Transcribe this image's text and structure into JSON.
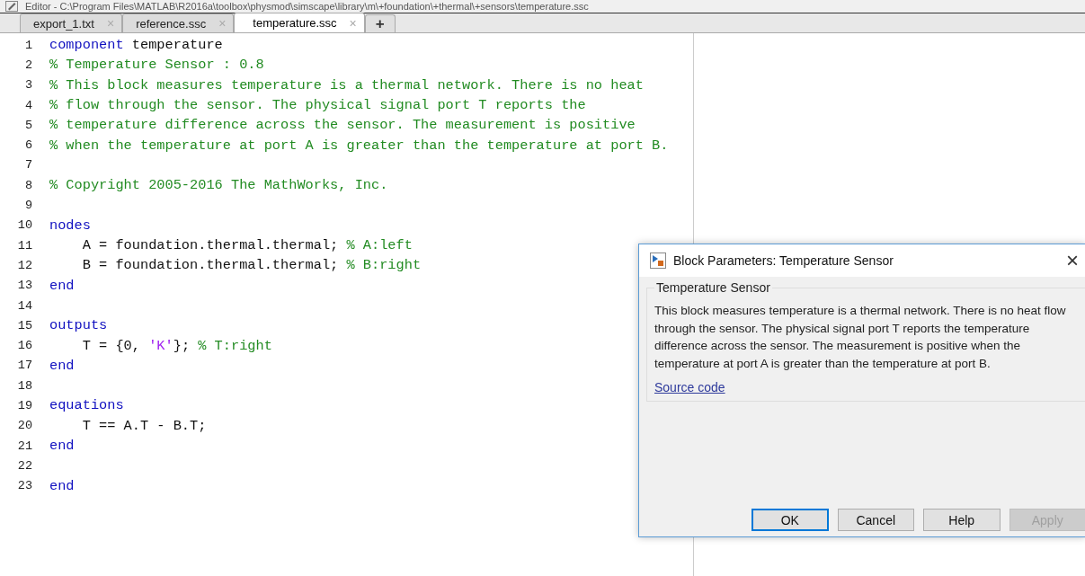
{
  "window": {
    "title": "Editor - C:\\Program Files\\MATLAB\\R2016a\\toolbox\\physmod\\simscape\\library\\m\\+foundation\\+thermal\\+sensors\\temperature.ssc"
  },
  "tabs": [
    {
      "label": "export_1.txt",
      "selected": false,
      "close": "×"
    },
    {
      "label": "reference.ssc",
      "selected": false,
      "close": "×"
    },
    {
      "label": "temperature.ssc",
      "selected": true,
      "close": "×"
    }
  ],
  "new_tab": "+",
  "code": [
    {
      "number": "1",
      "tokens": [
        {
          "kind": "keyword",
          "text": "component"
        },
        {
          "kind": "plain",
          "text": " temperature"
        }
      ]
    },
    {
      "number": "2",
      "tokens": [
        {
          "kind": "comment",
          "text": "% Temperature Sensor : 0.8"
        }
      ]
    },
    {
      "number": "3",
      "tokens": [
        {
          "kind": "comment",
          "text": "% This block measures temperature is a thermal network. There is no heat"
        }
      ]
    },
    {
      "number": "4",
      "tokens": [
        {
          "kind": "comment",
          "text": "% flow through the sensor. The physical signal port T reports the"
        }
      ]
    },
    {
      "number": "5",
      "tokens": [
        {
          "kind": "comment",
          "text": "% temperature difference across the sensor. The measurement is positive"
        }
      ]
    },
    {
      "number": "6",
      "tokens": [
        {
          "kind": "comment",
          "text": "% when the temperature at port A is greater than the temperature at port B."
        }
      ]
    },
    {
      "number": "7"
    },
    {
      "number": "8",
      "tokens": [
        {
          "kind": "comment",
          "text": "% Copyright 2005-2016 The MathWorks, Inc."
        }
      ]
    },
    {
      "number": "9"
    },
    {
      "number": "10",
      "tokens": [
        {
          "kind": "keyword",
          "text": "nodes"
        }
      ]
    },
    {
      "number": "11",
      "tokens": [
        {
          "kind": "plain",
          "text": "    A = foundation.thermal.thermal; "
        },
        {
          "kind": "comment",
          "text": "% A:left"
        }
      ]
    },
    {
      "number": "12",
      "tokens": [
        {
          "kind": "plain",
          "text": "    B = foundation.thermal.thermal; "
        },
        {
          "kind": "comment",
          "text": "% B:right"
        }
      ]
    },
    {
      "number": "13",
      "tokens": [
        {
          "kind": "keyword",
          "text": "end"
        }
      ]
    },
    {
      "number": "14"
    },
    {
      "number": "15",
      "tokens": [
        {
          "kind": "keyword",
          "text": "outputs"
        }
      ]
    },
    {
      "number": "16",
      "tokens": [
        {
          "kind": "plain",
          "text": "    T = {0, "
        },
        {
          "kind": "string",
          "text": "'K'"
        },
        {
          "kind": "plain",
          "text": "}; "
        },
        {
          "kind": "comment",
          "text": "% T:right"
        }
      ]
    },
    {
      "number": "17",
      "tokens": [
        {
          "kind": "keyword",
          "text": "end"
        }
      ]
    },
    {
      "number": "18"
    },
    {
      "number": "19",
      "tokens": [
        {
          "kind": "keyword",
          "text": "equations"
        }
      ]
    },
    {
      "number": "20",
      "tokens": [
        {
          "kind": "plain",
          "text": "    T == A.T - B.T;"
        }
      ]
    },
    {
      "number": "21",
      "tokens": [
        {
          "kind": "keyword",
          "text": "end"
        }
      ]
    },
    {
      "number": "22"
    },
    {
      "number": "23",
      "tokens": [
        {
          "kind": "keyword",
          "text": "end"
        }
      ]
    }
  ],
  "dialog": {
    "title": "Block Parameters: Temperature Sensor",
    "close": "×",
    "group": "Temperature Sensor",
    "description": "This block measures temperature is a thermal network. There is no heat flow through the sensor. The physical signal port T reports the temperature difference across the sensor. The measurement is positive when the temperature at port A is greater than the temperature at port B.",
    "link": "Source code",
    "buttons": [
      {
        "label": "OK",
        "default": true,
        "disabled": false
      },
      {
        "label": "Cancel",
        "default": false,
        "disabled": false
      },
      {
        "label": "Help",
        "default": false,
        "disabled": false
      },
      {
        "label": "Apply",
        "default": false,
        "disabled": true
      }
    ]
  }
}
